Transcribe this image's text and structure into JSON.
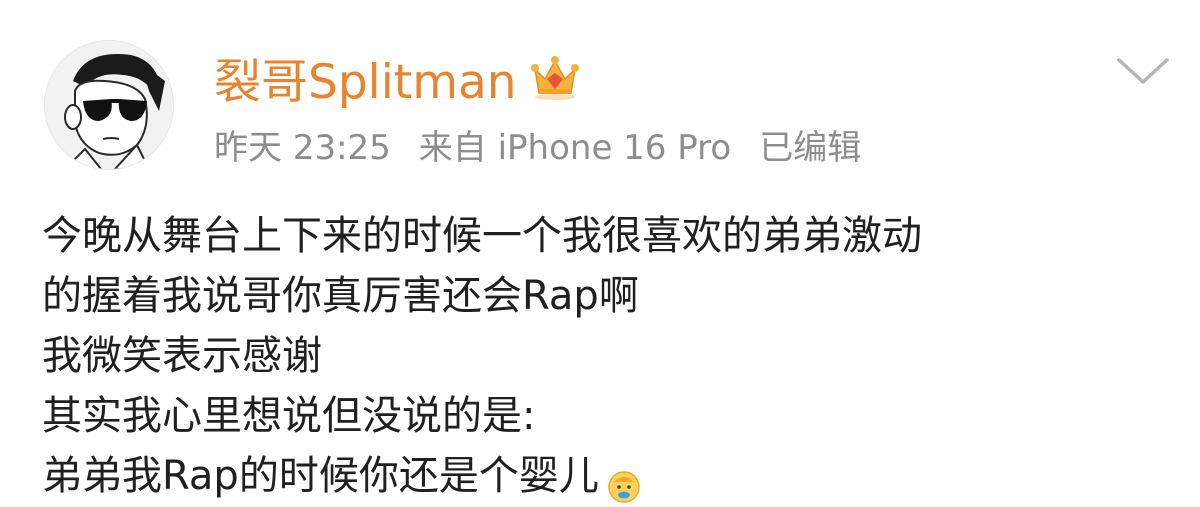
{
  "post": {
    "author": {
      "name": "裂哥Splitman",
      "badge_icon": "crown-icon"
    },
    "meta": {
      "time": "昨天 23:25",
      "source": "来自 iPhone 16 Pro",
      "edited": "已编辑"
    },
    "body_lines": [
      "今晚从舞台上下来的时候一个我很喜欢的弟弟激动",
      "的握着我说哥你真厉害还会Rap啊",
      "我微笑表示感谢",
      "其实我心里想说但没说的是:",
      "弟弟我Rap的时候你还是个婴儿"
    ],
    "trailing_emoji": "baby-emoji-icon"
  },
  "colors": {
    "username": "#e8832e",
    "meta": "#8d8d8d",
    "body": "#202020",
    "chevron": "#b5b5b5"
  }
}
